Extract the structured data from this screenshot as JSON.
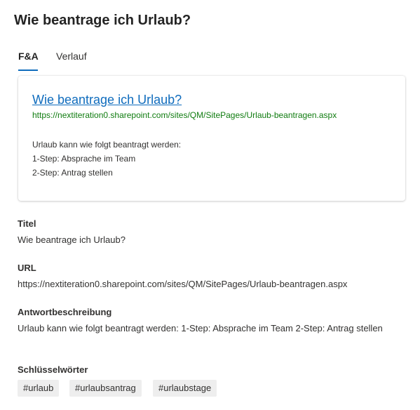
{
  "header": {
    "title": "Wie beantrage ich Urlaub?"
  },
  "tabs": [
    {
      "label": "F&A",
      "active": true
    },
    {
      "label": "Verlauf",
      "active": false
    }
  ],
  "preview_card": {
    "title": "Wie beantrage ich Urlaub?",
    "url": "https://nextiteration0.sharepoint.com/sites/QM/SitePages/Urlaub-beantragen.aspx",
    "description_lines": [
      "Urlaub kann wie folgt beantragt werden:",
      "1-Step: Absprache im Team",
      "2-Step: Antrag stellen"
    ]
  },
  "fields": {
    "title": {
      "label": "Titel",
      "value": "Wie beantrage ich Urlaub?"
    },
    "url": {
      "label": "URL",
      "value": "https://nextiteration0.sharepoint.com/sites/QM/SitePages/Urlaub-beantragen.aspx"
    },
    "answer": {
      "label": "Antwortbeschreibung",
      "value": "Urlaub kann wie folgt beantragt werden: 1-Step: Absprache im Team 2-Step: Antrag stellen"
    },
    "keywords": {
      "label": "Schlüsselwörter",
      "tags": [
        "#urlaub",
        "#urlaubsantrag",
        "#urlaubstage"
      ]
    }
  },
  "colors": {
    "accent": "#0f6cbd",
    "link": "#0f6cbd",
    "url_green": "#107c10",
    "tag_bg": "#eeeeee"
  }
}
